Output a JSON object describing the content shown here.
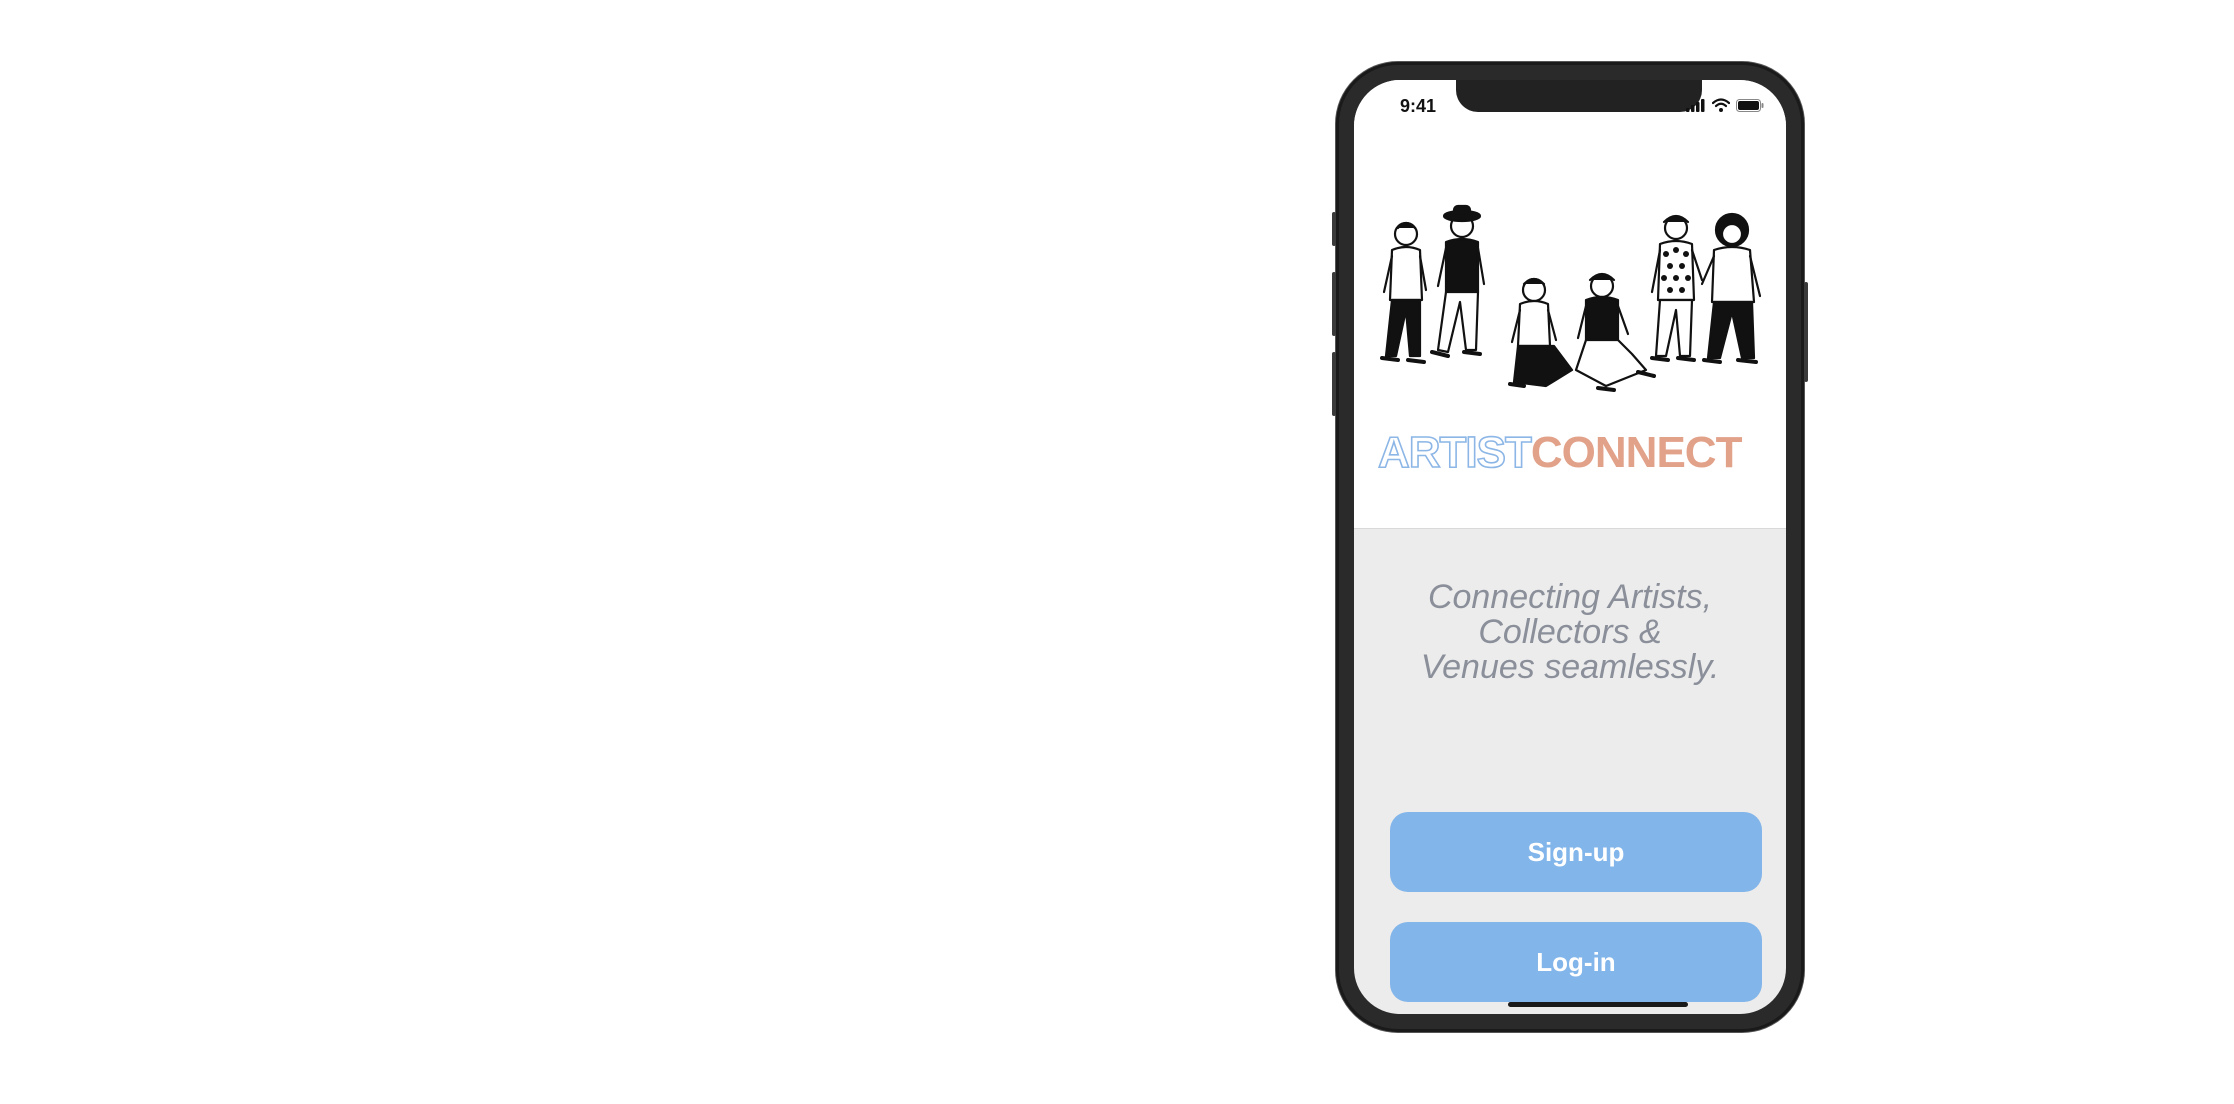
{
  "status_bar": {
    "time": "9:41"
  },
  "logo": {
    "part1": "ARTIST",
    "part2": "CONNECT"
  },
  "tagline": {
    "line1": "Connecting Artists,",
    "line2": "Collectors &",
    "line3": "Venues seamlessly."
  },
  "buttons": {
    "signup_label": "Sign-up",
    "login_label": "Log-in"
  },
  "colors": {
    "button": "#82b5ea",
    "logo_outline": "#8cb6e6",
    "logo_fill": "#e2a189",
    "screen_bg": "#ececec",
    "tagline": "#8a8f9a"
  },
  "icons": [
    "signal-icon",
    "wifi-icon",
    "battery-icon",
    "people-illustration"
  ]
}
